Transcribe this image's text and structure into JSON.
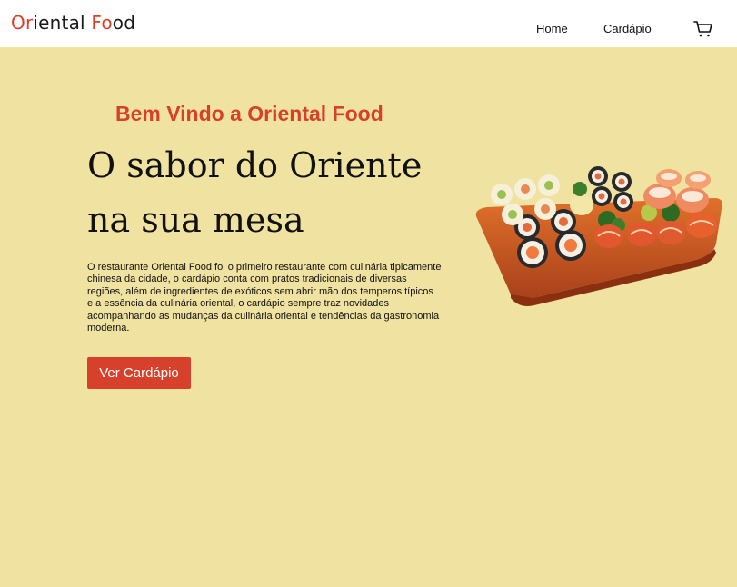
{
  "header": {
    "logo": {
      "part1": "Or",
      "part2": "i",
      "part3": "ental ",
      "part4": "Fo",
      "part5": "od"
    },
    "nav": {
      "home": "Home",
      "menu": "Cardápio"
    },
    "cart_icon": "shopping-cart-icon"
  },
  "hero": {
    "welcome": "Bem Vindo a Oriental Food",
    "headline_line1": "O sabor do Oriente",
    "headline_line2": "na sua mesa",
    "description": "O restaurante Oriental Food foi o primeiro restaurante com culinária tipicamente chinesa da cidade, o cardápio conta com pratos tradicionais de diversas regiões, além de ingredientes de exóticos sem abrir mão dos temperos típicos e a essência da culinária oriental, o cardápio sempre traz novidades acompanhando as mudanças da culinária oriental e tendências da gastronomia moderna.",
    "cta": "Ver Cardápio",
    "image": "sushi-platter-image"
  },
  "colors": {
    "background": "#f0e2a0",
    "accent": "#d7402a",
    "header": "#ffffff"
  }
}
